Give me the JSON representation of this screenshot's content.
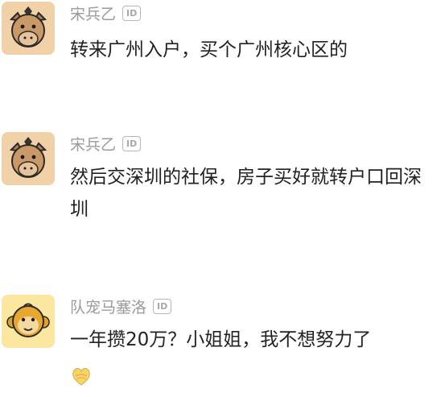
{
  "comments": [
    {
      "username": "宋兵乙",
      "id_badge": "ID",
      "text": "转来广州入户，买个广州核心区的",
      "avatar": "donkey-avatar-icon"
    },
    {
      "username": "宋兵乙",
      "id_badge": "ID",
      "text": "然后交深圳的社保，房子买好就转户口回深圳",
      "avatar": "donkey-avatar-icon"
    },
    {
      "username": "队宠马塞洛",
      "id_badge": "ID",
      "text": "一年攒20万？小姐姐，我不想努力了",
      "avatar": "monkey-avatar-icon",
      "emoji": "heart-hands-emoji-icon"
    }
  ],
  "colors": {
    "username": "#9a9a9a",
    "text": "#222222",
    "donkey_bg": "#f1d1a8",
    "monkey_bg": "#fbe7a0"
  }
}
